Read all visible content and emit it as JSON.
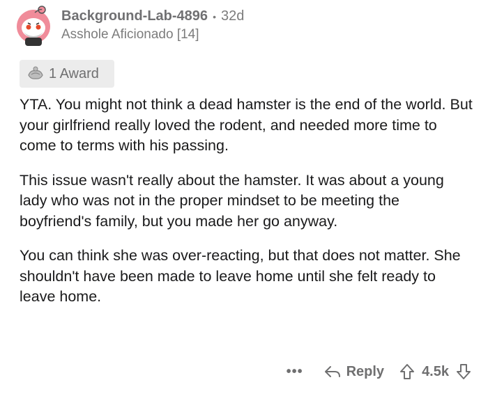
{
  "comment": {
    "username": "Background-Lab-4896",
    "separator": "•",
    "age": "32d",
    "flair": "Asshole Aficionado [14]",
    "award_label": "1 Award",
    "paragraphs": [
      "YTA.  You might not think a dead hamster is the end of the world.  But your girlfriend really loved the rodent, and needed more time to come to terms with his passing.",
      "This issue wasn't really about the hamster.  It was about a young lady who was not in the proper mindset to be meeting the boyfriend's family, but you made her go anyway.",
      "You can think she was over-reacting, but that does not matter.  She shouldn't have been made to leave home until she felt ready to leave home."
    ]
  },
  "actions": {
    "more_label": "•••",
    "reply_label": "Reply",
    "score": "4.5k"
  },
  "icons": {
    "avatar": "snoo-avatar-icon",
    "award": "award-icon",
    "reply": "reply-arrow-icon",
    "upvote": "upvote-arrow-icon",
    "downvote": "downvote-arrow-icon"
  },
  "colors": {
    "text": "#1a1a1b",
    "meta": "#7c7c7c",
    "award_bg": "#ececec",
    "avatar_pink": "#f07b8c"
  }
}
